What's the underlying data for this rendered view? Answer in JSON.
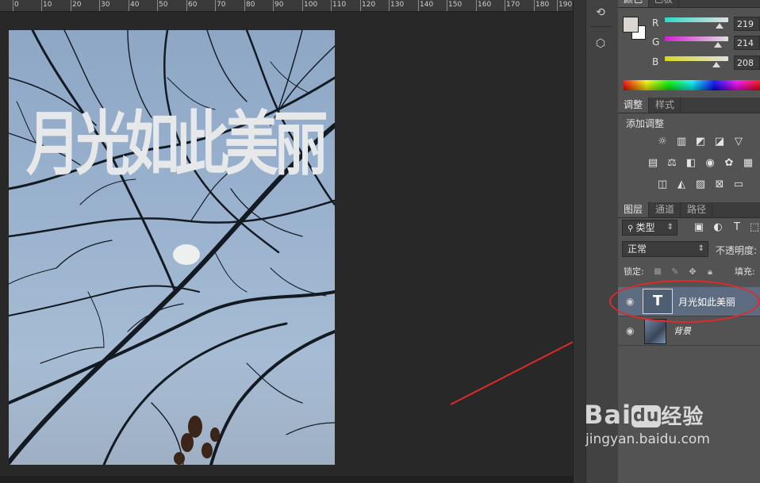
{
  "ruler": {
    "labels": [
      "0",
      "10",
      "20",
      "30",
      "40",
      "50",
      "60",
      "70",
      "80",
      "90",
      "100",
      "110",
      "120",
      "130",
      "140",
      "150",
      "160",
      "170",
      "180",
      "190"
    ]
  },
  "document": {
    "title_text": "月光如此美丽"
  },
  "color_panel": {
    "tabs": [
      {
        "label": "颜色"
      },
      {
        "label": "色板"
      }
    ],
    "foreground": "#dbd6d0",
    "background": "#ffffff",
    "channels": [
      {
        "label": "R",
        "value": "219",
        "gradient": [
          "#30d8c8",
          "#e0e0e0"
        ]
      },
      {
        "label": "G",
        "value": "214",
        "gradient": [
          "#d020d0",
          "#e0e0e0"
        ]
      },
      {
        "label": "B",
        "value": "208",
        "gradient": [
          "#d8d820",
          "#e0e0e0"
        ]
      }
    ]
  },
  "adjustments_panel": {
    "tabs": [
      {
        "label": "调整"
      },
      {
        "label": "样式"
      }
    ],
    "add_label": "添加调整"
  },
  "layers_panel": {
    "tabs": [
      {
        "label": "图层"
      },
      {
        "label": "通道"
      },
      {
        "label": "路径"
      }
    ],
    "filter_kind": "类型",
    "blend_mode": "正常",
    "opacity_label": "不透明度:",
    "lock_label": "锁定:",
    "fill_label": "填充:",
    "layers": [
      {
        "name": "月光如此美丽",
        "kind": "text",
        "thumb_glyph": "T",
        "selected": true
      },
      {
        "name": "背景",
        "kind": "image",
        "selected": false
      }
    ]
  },
  "annotation": {
    "color": "#e02a2a"
  },
  "watermark": {
    "brand": "Bai",
    "brand_glyph": "du",
    "brand_cn": "经验",
    "url": "jingyan.baidu.com"
  }
}
